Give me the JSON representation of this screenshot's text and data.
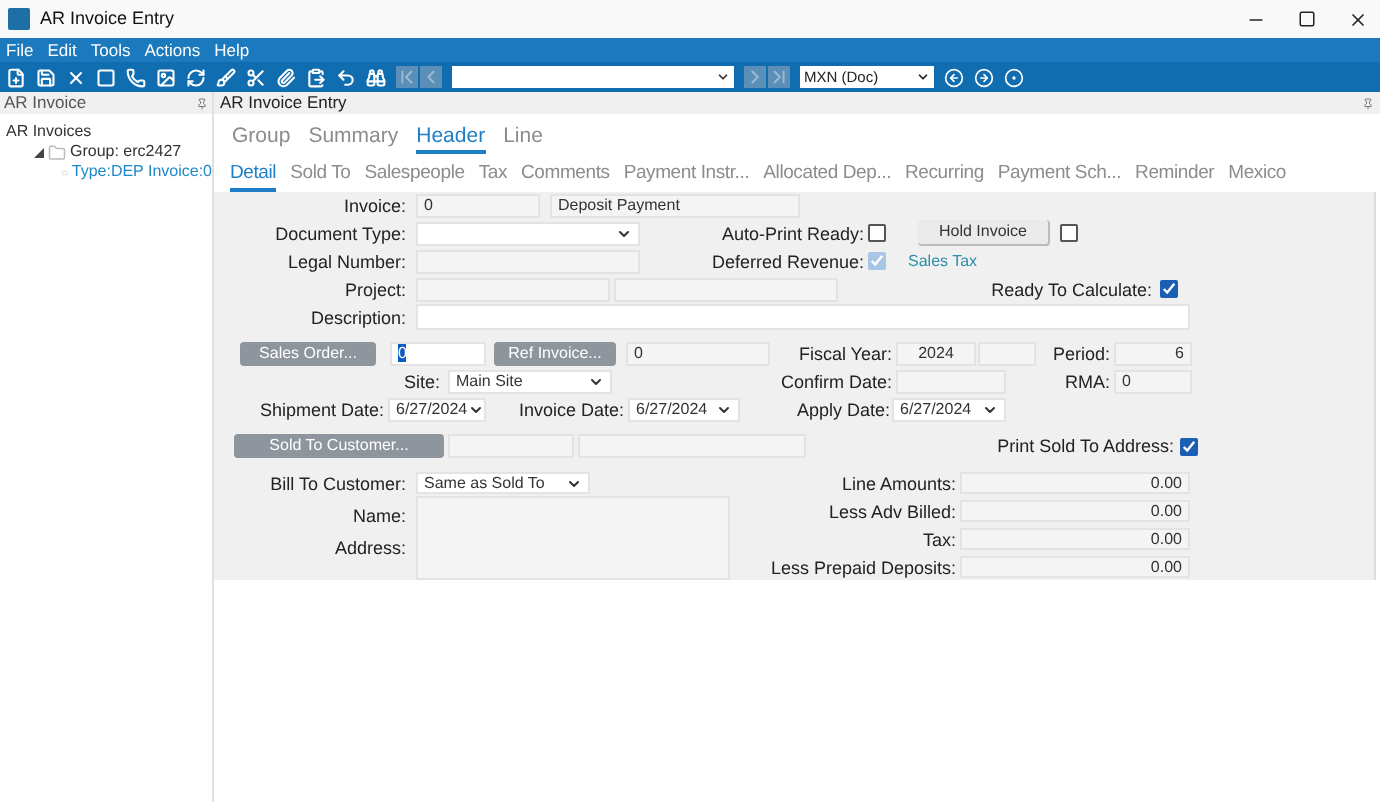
{
  "window": {
    "title": "AR Invoice Entry"
  },
  "menu": [
    "File",
    "Edit",
    "Tools",
    "Actions",
    "Help"
  ],
  "toolbar": {
    "currency_combo": {
      "value": "MXN (Doc)"
    }
  },
  "left_panel": {
    "title": "AR Invoice",
    "tree": [
      {
        "label": "AR Invoices",
        "children": [
          {
            "label": "Group: erc2427",
            "expanded": true,
            "children": [
              {
                "label": "Type:DEP Invoice:0",
                "selected": true
              }
            ]
          }
        ]
      }
    ]
  },
  "main_panel": {
    "title": "AR Invoice Entry"
  },
  "tabs": [
    {
      "label": "Group",
      "selected": false
    },
    {
      "label": "Summary",
      "selected": false
    },
    {
      "label": "Header",
      "selected": true
    },
    {
      "label": "Line",
      "selected": false
    }
  ],
  "subtabs": [
    {
      "label": "Detail",
      "selected": true
    },
    {
      "label": "Sold To",
      "selected": false
    },
    {
      "label": "Salespeople",
      "selected": false
    },
    {
      "label": "Tax",
      "selected": false
    },
    {
      "label": "Comments",
      "selected": false
    },
    {
      "label": "Payment Instr...",
      "selected": false
    },
    {
      "label": "Allocated Dep...",
      "selected": false
    },
    {
      "label": "Recurring",
      "selected": false
    },
    {
      "label": "Payment Sch...",
      "selected": false
    },
    {
      "label": "Reminder",
      "selected": false
    },
    {
      "label": "Mexico",
      "selected": false
    }
  ],
  "form": {
    "invoice": {
      "label": "Invoice:",
      "value": "0",
      "description": "Deposit Payment"
    },
    "document_type": {
      "label": "Document Type:"
    },
    "auto_print_ready": {
      "label": "Auto-Print Ready:",
      "checked": false
    },
    "hold_invoice": {
      "label": "Hold Invoice",
      "checked": false
    },
    "legal_number": {
      "label": "Legal Number:"
    },
    "deferred_revenue": {
      "label": "Deferred Revenue:",
      "checked": true,
      "disabled": true
    },
    "sales_tax_link": "Sales Tax",
    "project": {
      "label": "Project:"
    },
    "ready_to_calculate": {
      "label": "Ready To Calculate:",
      "checked": true
    },
    "description": {
      "label": "Description:"
    },
    "sales_order": {
      "label": "Sales Order...",
      "disabled": true,
      "value": "0"
    },
    "ref_invoice": {
      "label": "Ref Invoice...",
      "disabled": true,
      "value": "0"
    },
    "fiscal_year": {
      "label": "Fiscal Year:",
      "value": "2024"
    },
    "period": {
      "label": "Period:",
      "value": "6"
    },
    "site": {
      "label": "Site:",
      "value": "Main Site"
    },
    "confirm_date": {
      "label": "Confirm Date:"
    },
    "rma": {
      "label": "RMA:",
      "value": "0"
    },
    "shipment_date": {
      "label": "Shipment Date:",
      "value": "6/27/2024"
    },
    "invoice_date": {
      "label": "Invoice Date:",
      "value": "6/27/2024"
    },
    "apply_date": {
      "label": "Apply Date:",
      "value": "6/27/2024"
    },
    "sold_to_customer": {
      "label": "Sold To Customer...",
      "disabled": true
    },
    "print_sold_to_address": {
      "label": "Print Sold To Address:",
      "checked": true
    },
    "bill_to_customer": {
      "label": "Bill To Customer:",
      "value": "Same as Sold To"
    },
    "name": {
      "label": "Name:"
    },
    "address": {
      "label": "Address:"
    },
    "totals": [
      {
        "label": "Line Amounts:",
        "value": "0.00"
      },
      {
        "label": "Less Adv Billed:",
        "value": "0.00"
      },
      {
        "label": "Tax:",
        "value": "0.00"
      },
      {
        "label": "Less Prepaid Deposits:",
        "value": "0.00"
      }
    ]
  }
}
